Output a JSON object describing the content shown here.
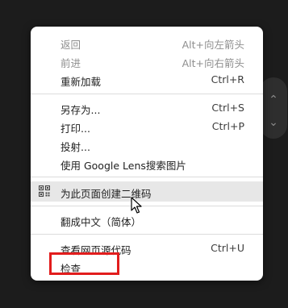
{
  "menu": {
    "items": [
      {
        "label": "返回",
        "shortcut": "Alt+向左箭头",
        "disabled": true
      },
      {
        "label": "前进",
        "shortcut": "Alt+向右箭头",
        "disabled": true
      },
      {
        "label": "重新加载",
        "shortcut": "Ctrl+R",
        "disabled": false
      },
      {
        "label": "另存为...",
        "shortcut": "Ctrl+S",
        "disabled": false
      },
      {
        "label": "打印...",
        "shortcut": "Ctrl+P",
        "disabled": false
      },
      {
        "label": "投射...",
        "shortcut": "",
        "disabled": false
      },
      {
        "label": "使用 Google Lens搜索图片",
        "shortcut": "",
        "disabled": false
      },
      {
        "label": "为此页面创建二维码",
        "shortcut": "",
        "disabled": false,
        "icon": "qr-code-icon",
        "highlighted": true
      },
      {
        "label": "翻成中文（简体）",
        "shortcut": "",
        "disabled": false
      },
      {
        "label": "查看网页源代码",
        "shortcut": "Ctrl+U",
        "disabled": false
      },
      {
        "label": "检查",
        "shortcut": "",
        "disabled": false,
        "annotated": true
      }
    ]
  },
  "colors": {
    "background": "#1c1c1c",
    "menu_bg": "#ffffff",
    "highlight_bg": "#e7e7e7",
    "disabled_text": "#8e8e8e",
    "annotation_red": "#e21d1d"
  },
  "scroll": {
    "up_icon": "chevron-up-icon",
    "down_icon": "chevron-down-icon"
  }
}
